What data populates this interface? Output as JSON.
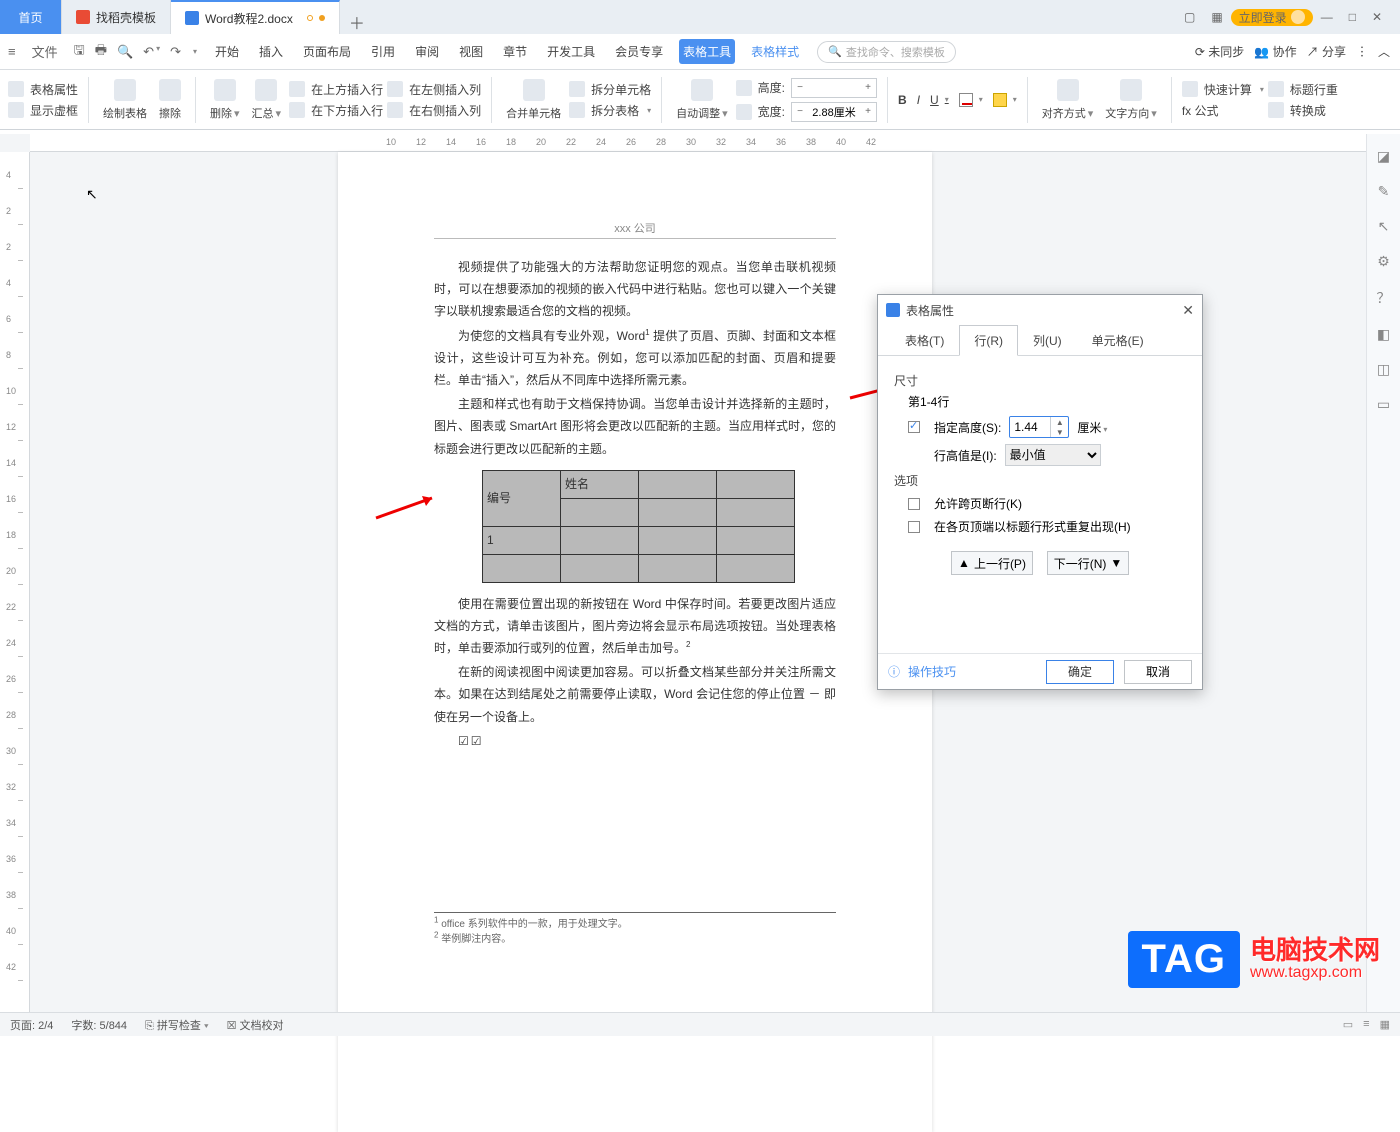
{
  "titlebar": {
    "home": "首页",
    "tab1": "找稻壳模板",
    "tab2": "Word教程2.docx",
    "newtab": "＋"
  },
  "win": {
    "login": "立即登录",
    "minimize": "―",
    "restore": "□",
    "close": "✕"
  },
  "menubar": {
    "file": "文件",
    "items": [
      "开始",
      "插入",
      "页面布局",
      "引用",
      "审阅",
      "视图",
      "章节",
      "开发工具",
      "会员专享"
    ],
    "table_tool": "表格工具",
    "table_style": "表格样式",
    "search_ph": "查找命令、搜索模板",
    "unsynced": "未同步",
    "coop": "协作",
    "share": "分享"
  },
  "ribbon": {
    "table_props": "表格属性",
    "show_frame": "显示虚框",
    "draw": "绘制表格",
    "erase": "擦除",
    "delete": "删除",
    "total": "汇总",
    "ins_above": "在上方插入行",
    "ins_below": "在下方插入行",
    "ins_left": "在左侧插入列",
    "ins_right": "在右侧插入列",
    "merge": "合并单元格",
    "split_cell": "拆分单元格",
    "split_tbl": "拆分表格",
    "autofit": "自动调整",
    "height_lbl": "高度:",
    "width_lbl": "宽度:",
    "width_val": "2.88厘米",
    "b": "B",
    "i": "I",
    "u": "U",
    "a": "A",
    "align": "对齐方式",
    "textdir": "文字方向",
    "quickcalc": "快速计算",
    "titlerow": "标题行重",
    "formula": "fx 公式",
    "convert": "转换成"
  },
  "doc": {
    "header": "xxx 公司",
    "p1": "视频提供了功能强大的方法帮助您证明您的观点。当您单击联机视频时，可以在想要添加的视频的嵌入代码中进行粘贴。您也可以键入一个关键字以联机搜索最适合您的文档的视频。",
    "p2_a": "为使您的文档具有专业外观，Word",
    "p2_b": " 提供了页眉、页脚、封面和文本框设计，这些设计可互为补充。例如，您可以添加匹配的封面、页眉和提要栏。单击“插入”，然后从不同库中选择所需元素。",
    "p3": "主题和样式也有助于文档保持协调。当您单击设计并选择新的主题时，图片、图表或 SmartArt 图形将会更改以匹配新的主题。当应用样式时，您的标题会进行更改以匹配新的主题。",
    "th1": "编号",
    "th2": "姓名",
    "row1": "1",
    "p4": "使用在需要位置出现的新按钮在 Word 中保存时间。若要更改图片适应文档的方式，请单击该图片，图片旁边将会显示布局选项按钮。当处理表格时，单击要添加行或列的位置，然后单击加号。",
    "p5": "在新的阅读视图中阅读更加容易。可以折叠文档某些部分并关注所需文本。如果在达到结尾处之前需要停止读取，Word 会记住您的停止位置 － 即使在另一个设备上。",
    "fn1": "office 系列软件中的一款，用于处理文字。",
    "fn2": "举例脚注内容。"
  },
  "dialog": {
    "title": "表格属性",
    "tabs": [
      "表格(T)",
      "行(R)",
      "列(U)",
      "单元格(E)"
    ],
    "size": "尺寸",
    "rows": "第1-4行",
    "spec_h": "指定高度(S):",
    "spec_h_val": "1.44",
    "unit": "厘米",
    "row_h_is": "行高值是(I):",
    "row_h_opt": "最小值",
    "options": "选项",
    "allow_break": "允许跨页断行(K)",
    "repeat_hdr": "在各页顶端以标题行形式重复出现(H)",
    "prev": "上一行(P)",
    "next": "下一行(N)",
    "tips": "操作技巧",
    "ok": "确定",
    "cancel": "取消"
  },
  "rtpane": [
    "◪",
    "✎",
    "↖",
    "⚙",
    "？",
    "◧",
    "◫",
    "▭"
  ],
  "status": {
    "page": "页面: 2/4",
    "words": "字数: 5/844",
    "spell": "拼写检查 ",
    "proof": "文档校对"
  },
  "ruler_h": [
    10,
    12,
    14,
    16,
    18,
    20,
    22,
    24,
    26,
    28,
    30,
    32,
    34,
    36,
    38,
    40,
    42
  ],
  "ruler_v": [
    4,
    2,
    2,
    4,
    6,
    8,
    10,
    12,
    14,
    16,
    18,
    20,
    22,
    24,
    26,
    28,
    30,
    32,
    34,
    36,
    38,
    40,
    42
  ],
  "wm": {
    "box": "TAG",
    "t1": "电脑技术网",
    "t2": "www.tagxp.com"
  }
}
